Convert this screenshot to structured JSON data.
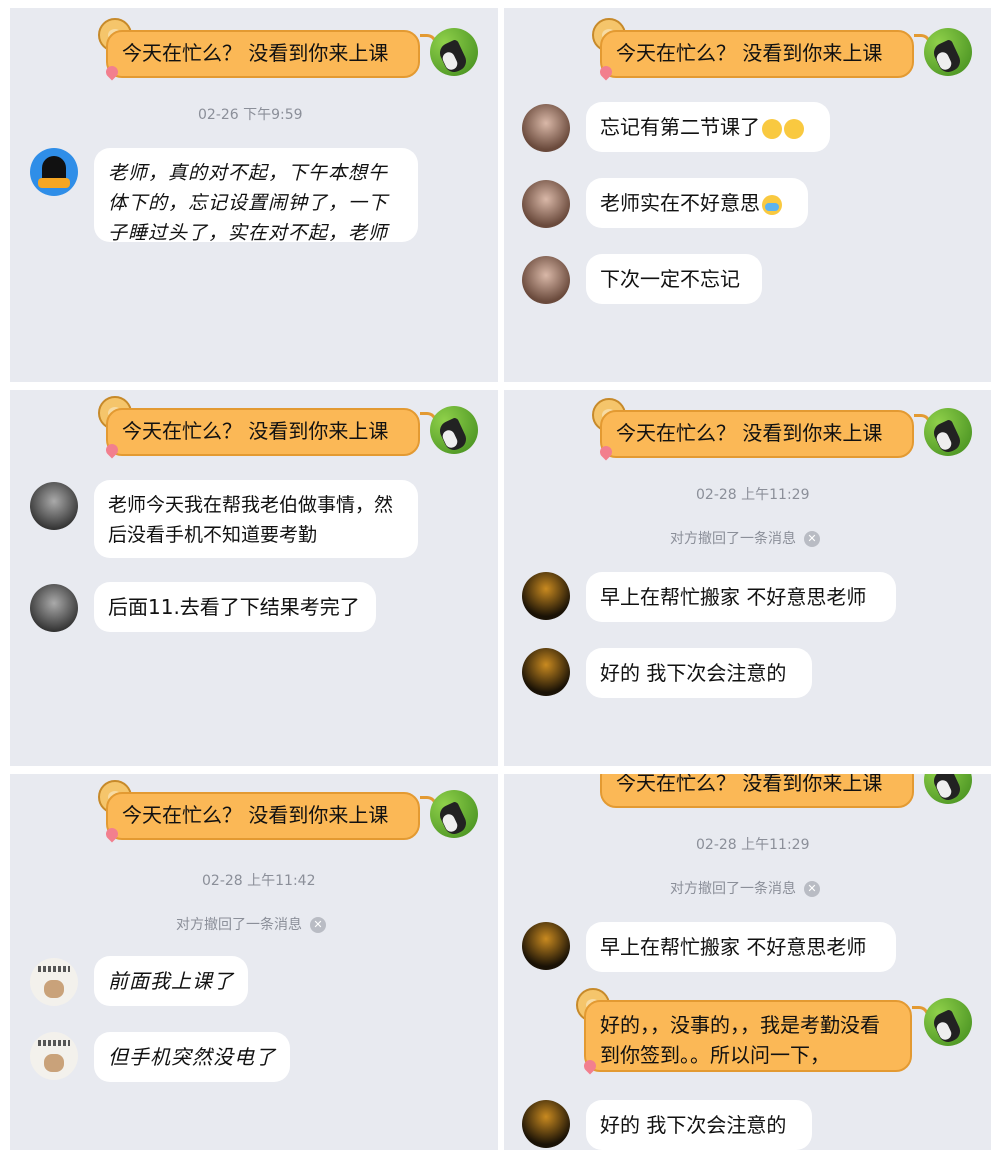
{
  "outgoing_text": "今天在忙么？ 没看到你来上课",
  "panel1": {
    "time": "02-26 下午9:59",
    "msg1": "老师，真的对不起，下午本想午体下的，忘记设置闹钟了，一下子睡过头了，实在对不起，老师"
  },
  "panel2": {
    "msg1": "忘记有第二节课了",
    "msg2": "老师实在不好意思",
    "msg3": "下次一定不忘记"
  },
  "panel3": {
    "msg1": "老师今天我在帮我老伯做事情，然后没看手机不知道要考勤",
    "msg2": "后面11.去看了下结果考完了"
  },
  "panel4": {
    "time": "02-28 上午11:29",
    "recall": "对方撤回了一条消息",
    "msg1": "早上在帮忙搬家 不好意思老师",
    "msg2": "好的 我下次会注意的"
  },
  "panel5": {
    "time": "02-28 上午11:42",
    "recall": "对方撤回了一条消息",
    "msg1": "前面我上课了",
    "msg2": "但手机突然没电了"
  },
  "panel6": {
    "time": "02-28 上午11:29",
    "recall": "对方撤回了一条消息",
    "msg1": "早上在帮忙搬家 不好意思老师",
    "reply": "好的，，没事的，，我是考勤没看到你签到。。所以问一下，",
    "msg2": "好的 我下次会注意的"
  },
  "icons": {
    "recall_close": "close-circle-icon",
    "emoji_surprised": "surprised-emoji-icon",
    "emoji_crying": "crying-emoji-icon"
  },
  "colors": {
    "panel_bg": "#e8eaf0",
    "outgoing_bubble": "#fbb856",
    "incoming_bubble": "#ffffff"
  }
}
